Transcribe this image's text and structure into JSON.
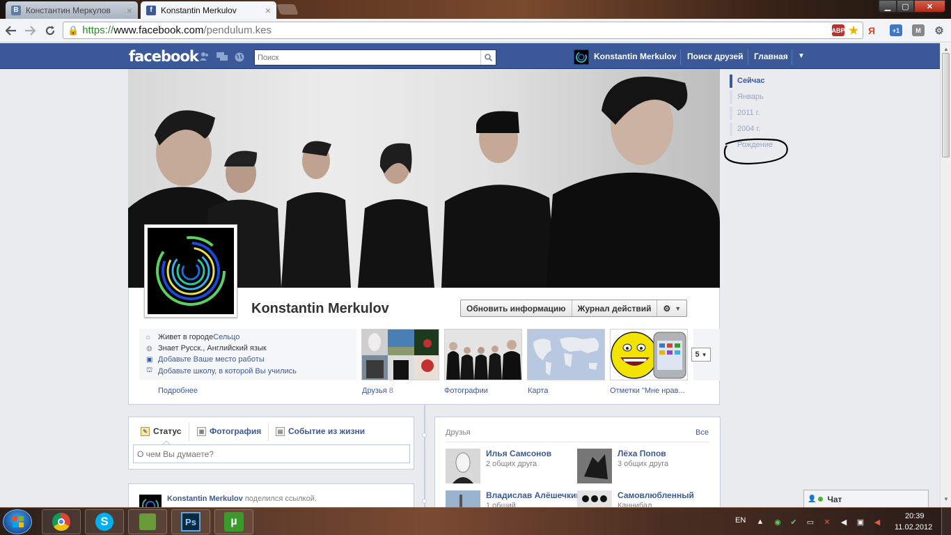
{
  "browser": {
    "tabs": [
      {
        "favicon": "В",
        "title": "Константин Меркулов",
        "close": "×",
        "favicon_color": "#5b7fa6"
      },
      {
        "favicon": "f",
        "title": "Konstantin Merkulov",
        "close": "×",
        "favicon_color": "#3b5998"
      }
    ],
    "url": {
      "scheme": "https://",
      "host": "www.facebook.com",
      "path": "/pendulum.kes"
    },
    "window_controls": {
      "minimize": "▁",
      "maximize": "▢",
      "close": "✕"
    },
    "nav_icons": {
      "back": "back-arrow-icon",
      "forward": "forward-arrow-icon",
      "reload": "reload-icon"
    },
    "extensions": [
      {
        "name": "adblock-icon",
        "label": "ABP",
        "color": "#c0302a"
      },
      {
        "name": "star-icon",
        "label": "★",
        "color": "#e8b400"
      },
      {
        "name": "yandex-mail-icon",
        "label": "Я",
        "color": "#d04a2a"
      },
      {
        "name": "plus-one-icon",
        "label": "+1",
        "color": "#3a78c8"
      },
      {
        "name": "gmail-icon",
        "label": "M",
        "color": "#888888"
      },
      {
        "name": "wrench-icon",
        "label": "⚙",
        "color": "#777777"
      }
    ]
  },
  "fb": {
    "logo": "facebook",
    "search_placeholder": "Поиск",
    "user_name": "Konstantin Merkulov",
    "find_friends": "Поиск друзей",
    "home": "Главная",
    "brand_color": "#3b5998"
  },
  "profile": {
    "name": "Konstantin Merkulov",
    "actions": {
      "update_info": "Обновить информацию",
      "activity_log": "Журнал действий",
      "gear": "⚙"
    },
    "about": {
      "lives_prefix": "Живет в городе ",
      "lives_city": "Сельцо",
      "languages": "Знает Русск., Английский язык",
      "add_work": "Добавьте Ваше место работы",
      "add_school": "Добавьте школу, в которой Вы учились",
      "more": "Подробнее"
    },
    "tiles": {
      "friends_label": "Друзья",
      "friends_count": "8",
      "photos_label": "Фотографии",
      "map_label": "Карта",
      "likes_label": "Отметки \"Мне нрав...",
      "more_count": "5"
    }
  },
  "timeline_nav": [
    "Сейчас",
    "Январь",
    "2011 г.",
    "2004 г.",
    "Рождение"
  ],
  "composer": {
    "tab_status": "Статус",
    "tab_photo": "Фотография",
    "tab_life_event": "Событие из жизни",
    "placeholder": "О чем Вы думаете?"
  },
  "story": {
    "author": "Konstantin Merkulov",
    "action": " поделился ссылкой."
  },
  "friends_box": {
    "title": "Друзья",
    "all": "Все",
    "items": [
      {
        "name": "Илья Самсонов",
        "sub": "2 общих друга"
      },
      {
        "name": "Лёха Попов",
        "sub": "3 общих друга"
      },
      {
        "name": "Владислав Алёшечкин",
        "sub": "1 общий"
      },
      {
        "name": "Самовлюбленный",
        "sub": "Каннибал"
      }
    ]
  },
  "chat": {
    "label": "Чат"
  },
  "taskbar": {
    "lang": "EN",
    "time": "20:39",
    "date": "11.02.2012",
    "apps": [
      "chrome-icon",
      "skype-icon",
      "app-icon",
      "photoshop-icon",
      "utorrent-icon"
    ],
    "ps_label": "Ps",
    "ut_label": "µ",
    "skype_label": "S"
  }
}
